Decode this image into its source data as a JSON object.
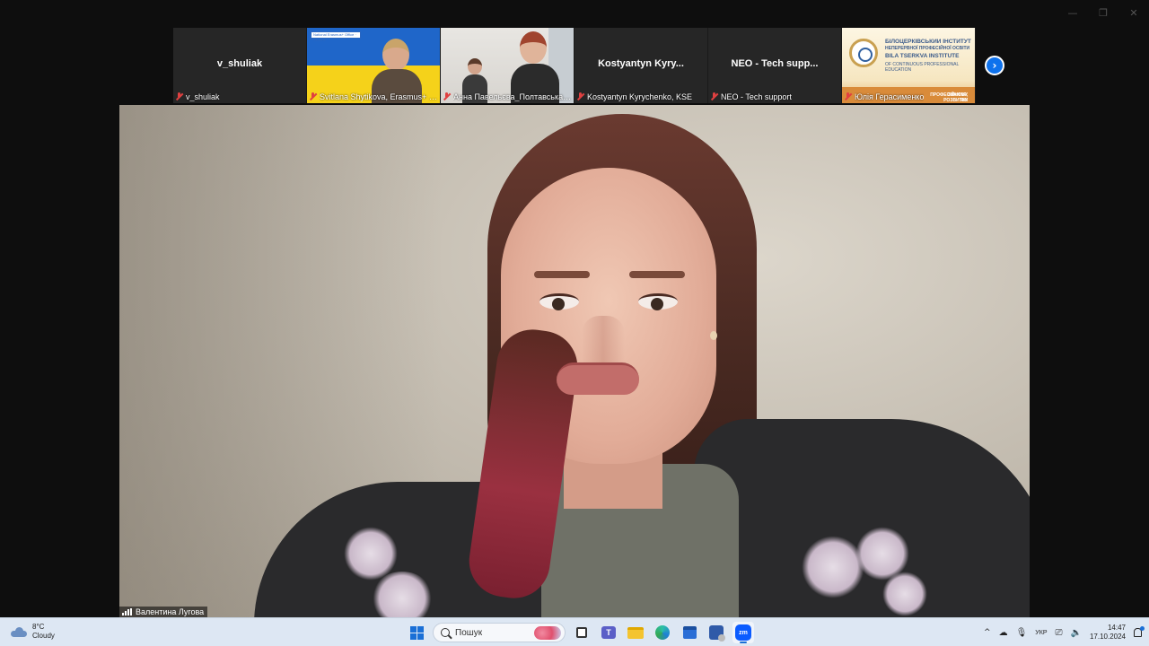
{
  "window": {
    "controls": [
      "—",
      "❐",
      "✕"
    ]
  },
  "participants": [
    {
      "id": "v_shuliak",
      "center_name": "v_shuliak",
      "label": "v_shuliak",
      "video": false,
      "muted": true
    },
    {
      "id": "svitlana",
      "center_name": "",
      "label": "Svitlana Shytikova, Erasmus+ Off...",
      "video": true,
      "muted": true,
      "minibar": "National Erasmus+ Office · Ukraine"
    },
    {
      "id": "anna",
      "center_name": "",
      "label": "Анна Павельєва_Полтавська по...",
      "video": true,
      "muted": true
    },
    {
      "id": "kostyantyn",
      "center_name": "Kostyantyn  Kyry...",
      "label": "Kostyantyn Kyrychenko, KSE",
      "video": false,
      "muted": true
    },
    {
      "id": "neo",
      "center_name": "NEO - Tech supp...",
      "label": "NEO - Tech support",
      "video": false,
      "muted": true
    },
    {
      "id": "yulia",
      "center_name": "",
      "label": "Юлія Герасименко",
      "video": true,
      "muted": true,
      "slide": {
        "line1": "БІЛОЦЕРКІВСЬКИЙ ІНСТИТУТ",
        "line1b": "НЕПЕРЕРВНОЇ ПРОФЕСІЙНОЇ ОСВІТИ",
        "line2": "BILA TSERKVA INSTITUTE",
        "line3": "OF CONTINUOUS PROFESSIONAL",
        "line4": "EDUCATION",
        "banner1": "ЗНАННЯ, ЯКІ ДАЮТЬ СТАРТ",
        "banner2": "ПРОФЕСІЙНОМУ РОЗВИТКУ"
      }
    }
  ],
  "next_page_icon": "chevron-right-icon",
  "speaker": {
    "name": "Валентина Лугова",
    "signal_icon": "signal-bars-icon"
  },
  "taskbar": {
    "weather": {
      "temp": "8°C",
      "condition": "Cloudy",
      "icon": "cloud-icon"
    },
    "search_placeholder": "Пошук",
    "apps": [
      "start",
      "search",
      "task-view",
      "teams",
      "file-explorer",
      "edge",
      "store",
      "app",
      "zoom"
    ],
    "tray": {
      "chevron": "^",
      "lang": "УКР",
      "time": "14:47",
      "date": "17.10.2024"
    }
  },
  "colors": {
    "zoom_blue": "#0e72ed",
    "muted_red": "#e04040",
    "taskbar_bg": "#dde7f3",
    "ukraine_blue": "#1f66c9",
    "ukraine_yellow": "#f5d21a"
  }
}
